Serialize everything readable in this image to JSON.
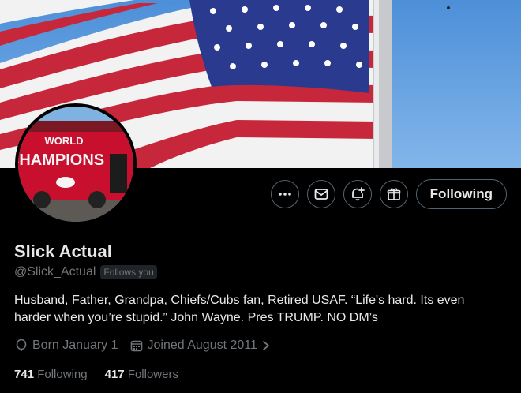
{
  "profile": {
    "display_name": "Slick Actual",
    "handle": "@Slick_Actual",
    "follows_you_badge": "Follows you",
    "bio": "Husband, Father, Grandpa, Chiefs/Cubs fan, Retired USAF. “Life's hard. Its even harder when you’re stupid.” John Wayne. Pres TRUMP. NO DM’s",
    "born": "Born January 1",
    "joined": "Joined August 2011"
  },
  "avatar": {
    "line1": "WORLD",
    "line2": "CHAMPIONS"
  },
  "actions": {
    "follow_label": "Following"
  },
  "stats": {
    "following_count": "741",
    "following_label": "Following",
    "followers_count": "417",
    "followers_label": "Followers"
  },
  "colors": {
    "background": "#000000",
    "muted": "#71767b",
    "border": "#536471",
    "text": "#e7e9ea"
  }
}
